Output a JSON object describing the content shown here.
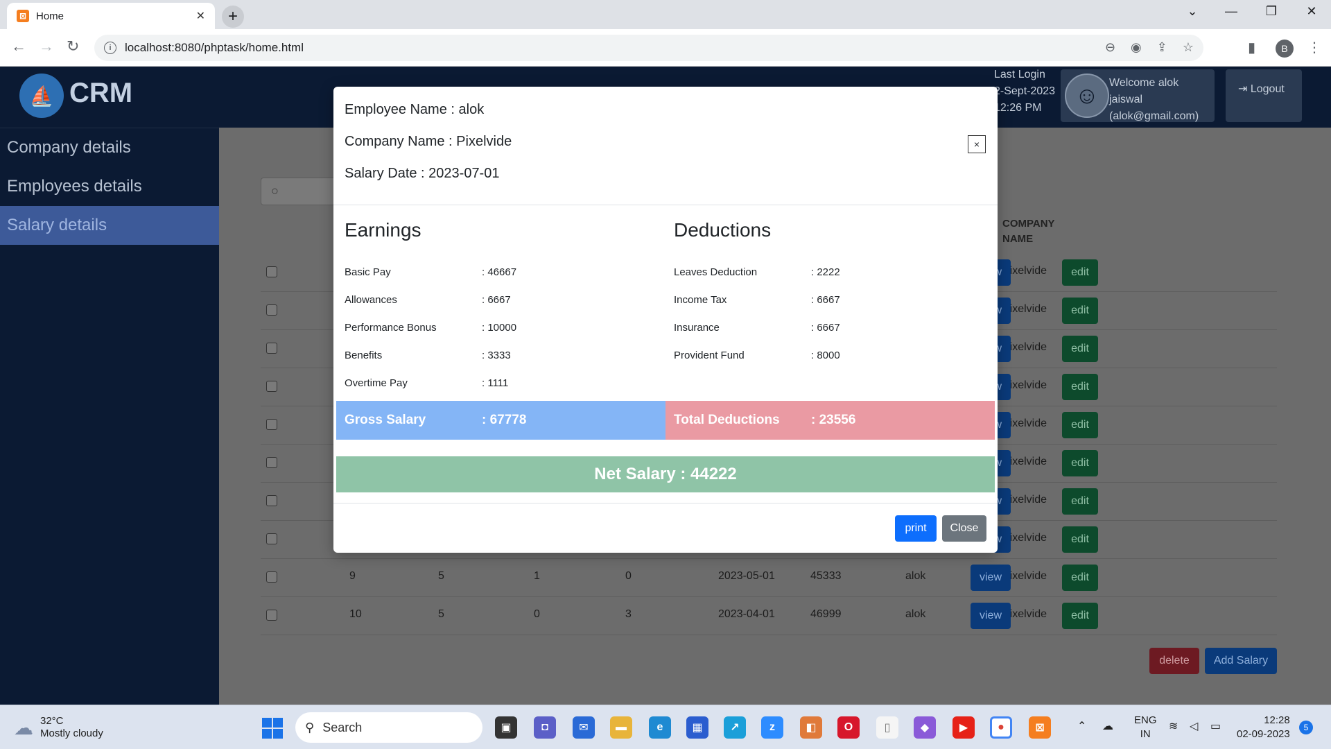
{
  "browser": {
    "tab_title": "Home",
    "url": "localhost:8080/phptask/home.html",
    "profile_initial": "B"
  },
  "header": {
    "logo_text": "CRM",
    "last_login_label": "Last Login",
    "last_login_date": "2-Sept-2023",
    "last_login_time": "12:26 PM",
    "welcome_text": "Welcome alok jaiswal",
    "welcome_email": "(alok@gmail.com)",
    "logout_label": "Logout"
  },
  "sidebar": {
    "items": [
      {
        "label": "Company details",
        "active": false
      },
      {
        "label": "Employees details",
        "active": false
      },
      {
        "label": "Salary details",
        "active": true
      }
    ]
  },
  "table": {
    "company_header_1": "COMPANY",
    "company_header_2": "NAME",
    "view_label": "view",
    "edit_label": "edit",
    "rows": [
      {
        "company": "Pixelvide"
      },
      {
        "company": "Pixelvide"
      },
      {
        "company": "Pixelvide"
      },
      {
        "company": "Pixelvide"
      },
      {
        "company": "Pixelvide"
      },
      {
        "company": "Pixelvide"
      },
      {
        "company": "Pixelvide"
      },
      {
        "company": "Pixelvide"
      },
      {
        "id": "9",
        "c2": "5",
        "c3": "1",
        "c4": "0",
        "date": "2023-05-01",
        "amount": "45333",
        "name": "alok",
        "company": "Pixelvide"
      },
      {
        "id": "10",
        "c2": "5",
        "c3": "0",
        "c4": "3",
        "date": "2023-04-01",
        "amount": "46999",
        "name": "alok",
        "company": "Pixelvide"
      }
    ],
    "delete_label": "delete",
    "add_label": "Add Salary"
  },
  "modal": {
    "employee_name": "Employee Name : alok",
    "company_name": "Company Name : Pixelvide",
    "salary_date": "Salary Date : 2023-07-01",
    "close_x": "×",
    "earnings_title": "Earnings",
    "earnings": [
      {
        "label": "Basic Pay",
        "value": ": 46667"
      },
      {
        "label": "Allowances",
        "value": ": 6667"
      },
      {
        "label": "Performance Bonus",
        "value": ": 10000"
      },
      {
        "label": "Benefits",
        "value": ": 3333"
      },
      {
        "label": "Overtime Pay",
        "value": ": 1111"
      }
    ],
    "deductions_title": "Deductions",
    "deductions": [
      {
        "label": "Leaves Deduction",
        "value": ": 2222"
      },
      {
        "label": "Income Tax",
        "value": ": 6667"
      },
      {
        "label": "Insurance",
        "value": ": 6667"
      },
      {
        "label": "Provident Fund",
        "value": ": 8000"
      }
    ],
    "gross_label": "Gross Salary",
    "gross_value": ": 67778",
    "total_deductions_label": "Total Deductions",
    "total_deductions_value": ": 23556",
    "net_salary": "Net Salary : 44222",
    "print_label": "print",
    "close_label": "Close"
  },
  "taskbar": {
    "temperature": "32°C",
    "weather": "Mostly cloudy",
    "search_placeholder": "Search",
    "lang_1": "ENG",
    "lang_2": "IN",
    "time": "12:28",
    "date": "02-09-2023",
    "notification_count": "5"
  }
}
